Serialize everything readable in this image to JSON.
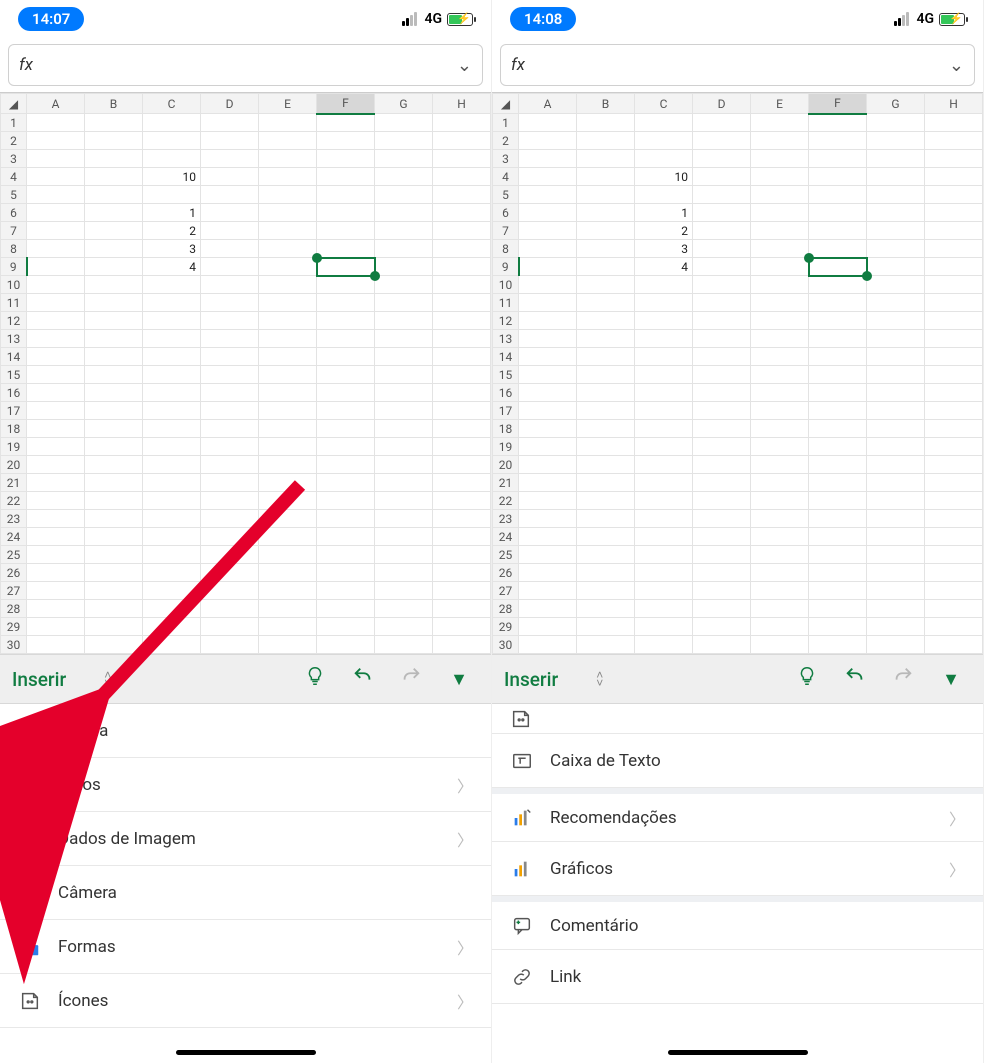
{
  "panes": [
    {
      "status": {
        "time": "14:07",
        "net": "4G"
      },
      "formula_prefix": "fx",
      "columns": [
        "A",
        "B",
        "C",
        "D",
        "E",
        "F",
        "G",
        "H"
      ],
      "rows": 30,
      "row_count_visible": 30,
      "selected_col": "F",
      "selected_row": 9,
      "cells": {
        "C4": "10",
        "C6": "1",
        "C7": "2",
        "C8": "3",
        "C9": "4"
      },
      "ribbon_title": "Inserir",
      "menu": [
        {
          "id": "tabela",
          "label": "Tabela",
          "chev": false,
          "icon": "table"
        },
        {
          "id": "fotos",
          "label": "Fotos",
          "chev": true,
          "icon": "photo"
        },
        {
          "id": "dados-imagem",
          "label": "Dados de Imagem",
          "chev": true,
          "icon": "camera-grid"
        },
        {
          "id": "camera",
          "label": "Câmera",
          "chev": false,
          "icon": "camera"
        },
        {
          "id": "formas",
          "label": "Formas",
          "chev": true,
          "icon": "shapes"
        },
        {
          "id": "icones",
          "label": "Ícones",
          "chev": true,
          "icon": "sticker"
        }
      ]
    },
    {
      "status": {
        "time": "14:08",
        "net": "4G"
      },
      "formula_prefix": "fx",
      "columns": [
        "A",
        "B",
        "C",
        "D",
        "E",
        "F",
        "G",
        "H"
      ],
      "rows": 30,
      "row_count_visible": 30,
      "selected_col": "F",
      "selected_row": 9,
      "cells": {
        "C4": "10",
        "C6": "1",
        "C7": "2",
        "C8": "3",
        "C9": "4"
      },
      "ribbon_title": "Inserir",
      "menu_partial_top": true,
      "menu": [
        {
          "id": "caixa-texto",
          "label": "Caixa de Texto",
          "chev": false,
          "icon": "textbox"
        },
        {
          "id": "recomendacoes",
          "label": "Recomendações",
          "chev": true,
          "icon": "chart-wand",
          "group": true
        },
        {
          "id": "graficos",
          "label": "Gráficos",
          "chev": true,
          "icon": "chart"
        },
        {
          "id": "comentario",
          "label": "Comentário",
          "chev": false,
          "icon": "comment",
          "group": true
        },
        {
          "id": "link",
          "label": "Link",
          "chev": false,
          "icon": "link"
        }
      ]
    }
  ],
  "icons": {
    "bulb": "bulb-icon",
    "undo": "undo-icon",
    "redo": "redo-icon",
    "collapse": "collapse-icon"
  }
}
